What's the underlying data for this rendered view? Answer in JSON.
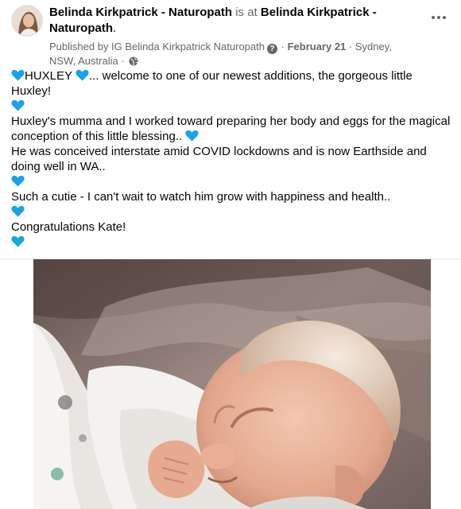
{
  "post": {
    "author": "Belinda Kirkpatrick - Naturopath",
    "is_at_label": "is at",
    "location_page": "Belinda Kirkpatrick - Naturopath",
    "trailing_period": ".",
    "published_by": "Published by IG Belinda Kirkpatrick Naturopath",
    "question_glyph": "?",
    "separator": "·",
    "date": "February 21",
    "place": "Sydney, NSW, Australia",
    "audience_icon": "globe-icon",
    "more_icon": "more-options-icon"
  },
  "body": {
    "line1_name": "HUXLEY",
    "line1_rest": "... welcome to one of our newest additions, the gorgeous little Huxley!",
    "para2": "Huxley's mumma and I worked toward preparing her body and eggs for the magical conception of this little blessing..",
    "para3": "He was conceived interstate amid COVID lockdowns and is now Earthside and doing well in WA..",
    "para4": "Such a cutie - I can't wait to watch him grow with happiness and health..",
    "para5": "Congratulations Kate!",
    "emoji_name": "blue-heart-icon",
    "emoji_color": "#1aa3e6"
  },
  "colors": {
    "text": "#050505",
    "muted": "#65676b",
    "divider": "#e4e6eb"
  }
}
